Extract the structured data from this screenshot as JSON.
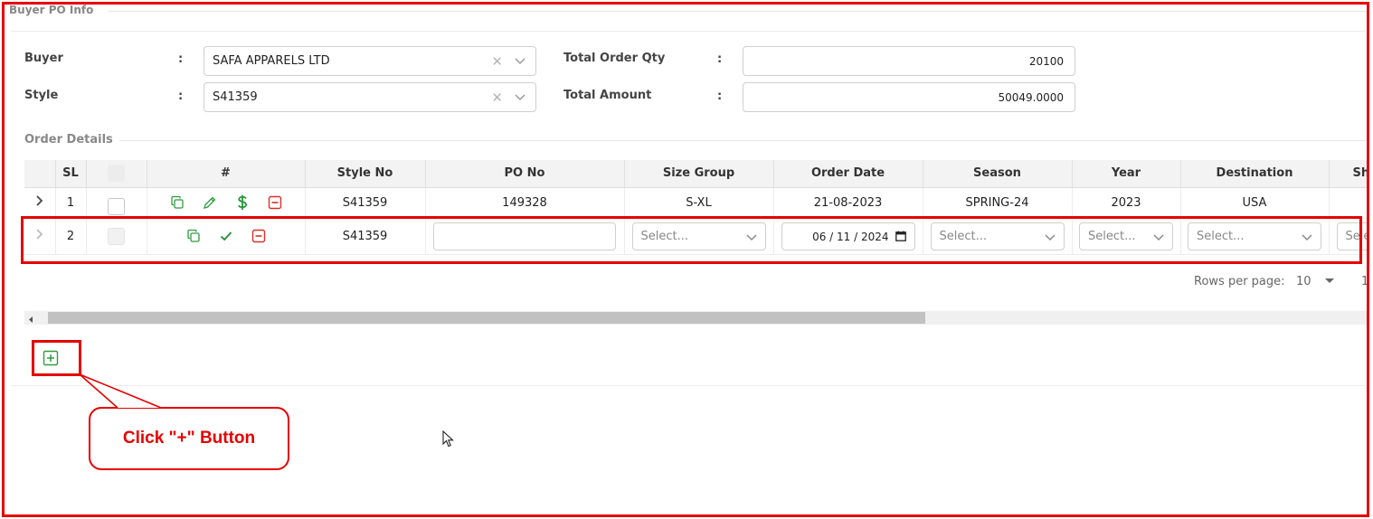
{
  "section": {
    "title": "Buyer PO Info"
  },
  "form": {
    "buyer_label": "Buyer",
    "buyer_value": "SAFA APPARELS LTD",
    "style_label": "Style",
    "style_value": "S41359",
    "total_qty_label": "Total Order Qty",
    "total_qty_value": "20100",
    "total_amount_label": "Total Amount",
    "total_amount_value": "50049.0000",
    "colon": ":"
  },
  "order_details": {
    "title": "Order Details",
    "columns": [
      "SL",
      "#",
      "Style No",
      "PO No",
      "Size Group",
      "Order Date",
      "Season",
      "Year",
      "Destination",
      "Sh"
    ],
    "rows": [
      {
        "sl": "1",
        "style_no": "S41359",
        "po_no": "149328",
        "size_group": "S-XL",
        "order_date": "21-08-2023",
        "season": "SPRING-24",
        "year": "2023",
        "destination": "USA"
      },
      {
        "sl": "2",
        "style_no": "S41359",
        "po_no": "",
        "size_group_placeholder": "Select...",
        "order_date": "06 / 11 / 2024",
        "season_placeholder": "Select...",
        "year_placeholder": "Select...",
        "destination_placeholder": "Select...",
        "extra_placeholder": "Sele"
      }
    ]
  },
  "pagination": {
    "rows_per_page_label": "Rows per page:",
    "rows_per_page_value": "10",
    "page_fragment": "1"
  },
  "callout": {
    "text": "Click \"+\" Button"
  },
  "colors": {
    "highlight": "#e60000",
    "action_green": "#2e9b3e",
    "action_red": "#d9302c"
  }
}
